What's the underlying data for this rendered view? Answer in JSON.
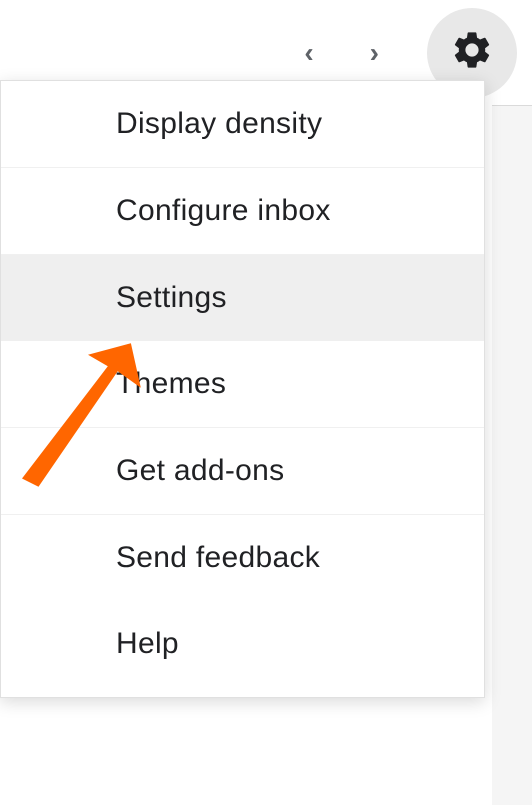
{
  "topbar": {
    "nav_prev": "‹",
    "nav_next": "›"
  },
  "menu": {
    "items": [
      {
        "label": "Display density",
        "highlighted": false,
        "group_end": true
      },
      {
        "label": "Configure inbox",
        "highlighted": false,
        "group_end": true
      },
      {
        "label": "Settings",
        "highlighted": true,
        "group_end": false
      },
      {
        "label": "Themes",
        "highlighted": false,
        "group_end": true
      },
      {
        "label": "Get add-ons",
        "highlighted": false,
        "group_end": true
      },
      {
        "label": "Send feedback",
        "highlighted": false,
        "group_end": false
      },
      {
        "label": "Help",
        "highlighted": false,
        "group_end": false
      }
    ]
  },
  "annotation": {
    "arrow_color": "#ff6600"
  }
}
